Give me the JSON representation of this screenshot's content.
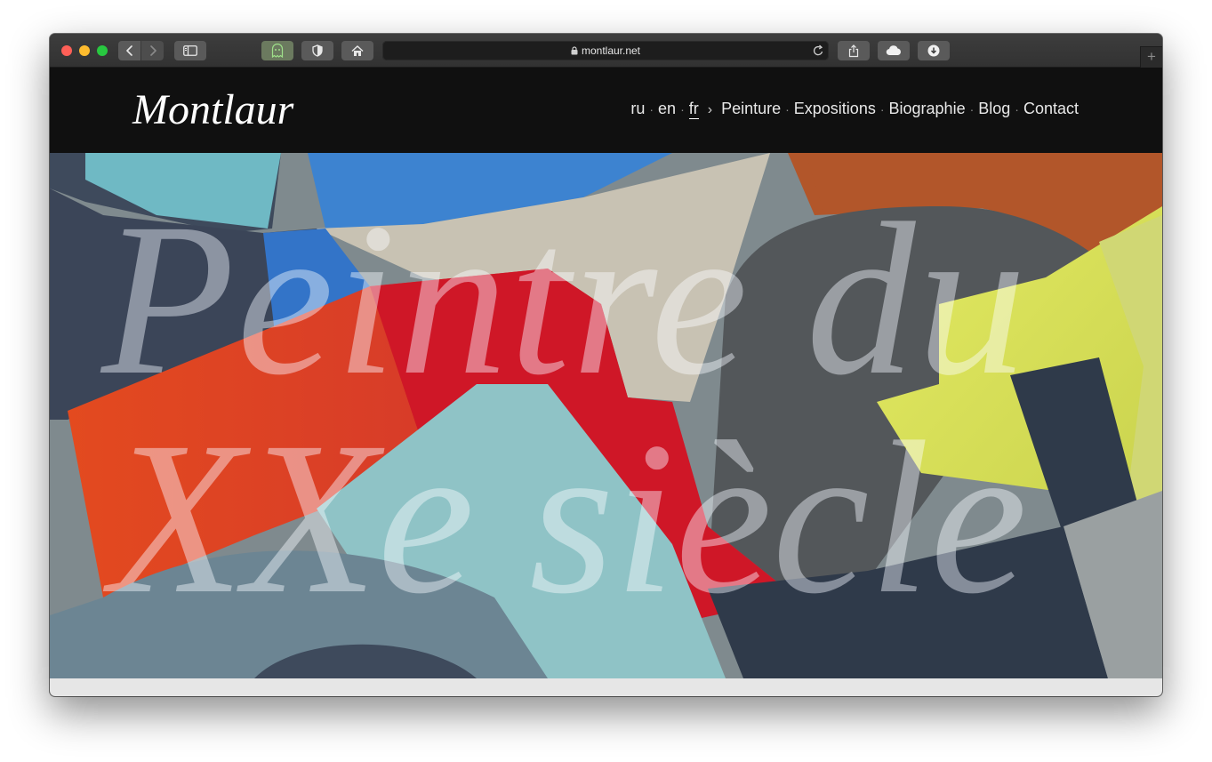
{
  "browser": {
    "url": "montlaur.net",
    "buttons": {
      "back": "chevron-left-icon",
      "forward": "chevron-right-icon",
      "sidebar": "sidebar-icon",
      "extension": "ghost-icon",
      "privacy": "shield-icon",
      "home": "home-icon",
      "reload": "reload-icon",
      "share": "share-icon",
      "cloud": "cloud-icon",
      "downloads": "download-icon",
      "new_tab": "+"
    }
  },
  "site": {
    "logo": "Montlaur",
    "languages": [
      "ru",
      "en",
      "fr"
    ],
    "active_language": "fr",
    "separator": "·",
    "chevron": "›",
    "menu": [
      "Peinture",
      "Expositions",
      "Biographie",
      "Blog",
      "Contact"
    ]
  },
  "hero": {
    "line1": "Peintre du",
    "line2": "XXe siècle"
  },
  "colors": {
    "header_bg": "#101010",
    "painting_red": "#d7162a",
    "painting_blue": "#3d7fcc",
    "painting_yellow": "#d9e35a",
    "painting_navy": "#2e3747"
  }
}
